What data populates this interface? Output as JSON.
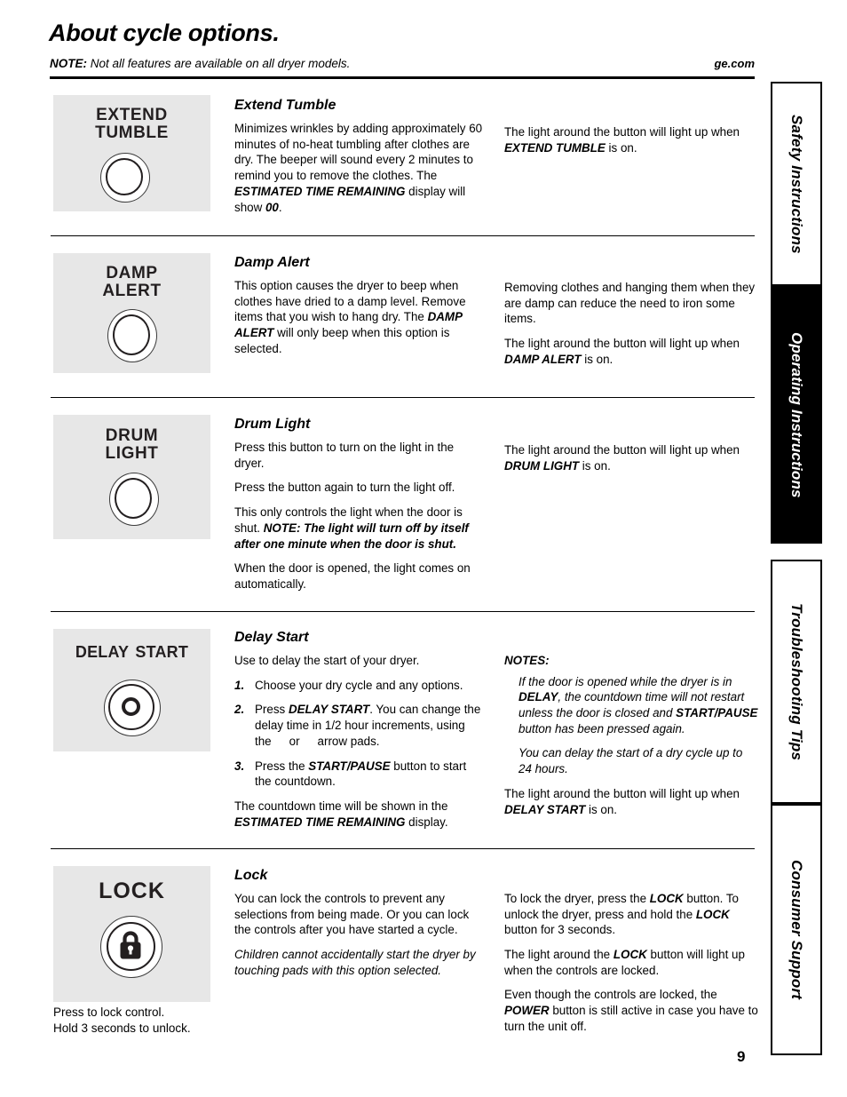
{
  "header": {
    "title": "About cycle options.",
    "note_label": "NOTE:",
    "note_text": " Not all features are available on all dryer models.",
    "site": "ge.com"
  },
  "sections": [
    {
      "id": "extend-tumble",
      "panel_label": "EXTEND\nTUMBLE",
      "panel_label_line1": "EXTEND",
      "panel_label_line2": "TUMBLE",
      "heading": "Extend Tumble",
      "middle": [
        "Minimizes wrinkles by adding approximately 60 minutes of no-heat tumbling after clothes are dry. The beeper will sound every 2 minutes to remind you to remove the clothes. The ESTIMATED TIME REMAINING display will show 00."
      ],
      "right": [
        "The light around the button will light up when EXTEND TUMBLE is on."
      ]
    },
    {
      "id": "damp-alert",
      "panel_label_line1": "DAMP",
      "panel_label_line2": "ALERT",
      "heading": "Damp Alert",
      "middle": [
        "This option causes the dryer to beep when clothes have dried to a damp level. Remove items that you wish to hang dry. The DAMP ALERT will only beep when this option is selected."
      ],
      "right": [
        "Removing clothes and hanging them when they are damp can reduce the need to iron some items.",
        "The light around the button will light up when DAMP ALERT is on."
      ]
    },
    {
      "id": "drum-light",
      "panel_label_line1": "DRUM",
      "panel_label_line2": "LIGHT",
      "heading": "Drum Light",
      "middle": [
        "Press this button to turn on the light in the dryer.",
        "Press the button again to turn the light off.",
        "This only controls the light when the door is shut. NOTE: The light will turn off by itself after one minute when the door is shut.",
        "When the door is opened, the light comes on automatically."
      ],
      "right": [
        "The light around the button will light up when DRUM LIGHT is on."
      ]
    },
    {
      "id": "delay-start",
      "panel_label_line1": "DELAY START",
      "heading": "Delay Start",
      "intro": "Use to delay the start of your dryer.",
      "steps": [
        {
          "num": "1.",
          "text": "Choose your dry cycle and any options."
        },
        {
          "num": "2.",
          "text": "Press DELAY START. You can change the delay time in 1/2 hour increments, using the  or  arrow pads."
        },
        {
          "num": "3.",
          "text": "Press the START/PAUSE button to start the countdown."
        }
      ],
      "closing": "The countdown time will be shown in the ESTIMATED TIME REMAINING display.",
      "notes_head": "NOTES:",
      "notes": [
        "If the door is opened while the dryer is in DELAY, the countdown time will not restart unless the door is closed and START/PAUSE button has been pressed again.",
        "You can delay the start of a dry cycle up to 24 hours."
      ],
      "right_closing": "The light around the button will light up when DELAY START is on."
    },
    {
      "id": "lock",
      "panel_label_line1": "LOCK",
      "heading": "Lock",
      "caption_line1": "Press to lock control.",
      "caption_line2": "Hold 3 seconds to unlock.",
      "middle": [
        "You can lock the controls to prevent any selections from being made. Or you can lock the controls after you have started a cycle.",
        "Children cannot accidentally start the dryer by touching pads with this option selected."
      ],
      "right": [
        "To lock the dryer, press the LOCK button. To unlock the dryer, press and hold the LOCK button for 3 seconds.",
        "The light around the LOCK button will light up when the controls are locked.",
        "Even though the controls are locked, the POWER button is still active in case you have to turn the unit off."
      ]
    }
  ],
  "tabs": [
    {
      "label": "Safety Instructions",
      "active": false
    },
    {
      "label": "Operating Instructions",
      "active": true
    },
    {
      "label": "Troubleshooting Tips",
      "active": false
    },
    {
      "label": "Consumer Support",
      "active": false
    }
  ],
  "page_number": "9",
  "colors": {
    "panel_gray": "#e7e7e7",
    "ink": "#000000",
    "button_stroke": "#231f20"
  }
}
